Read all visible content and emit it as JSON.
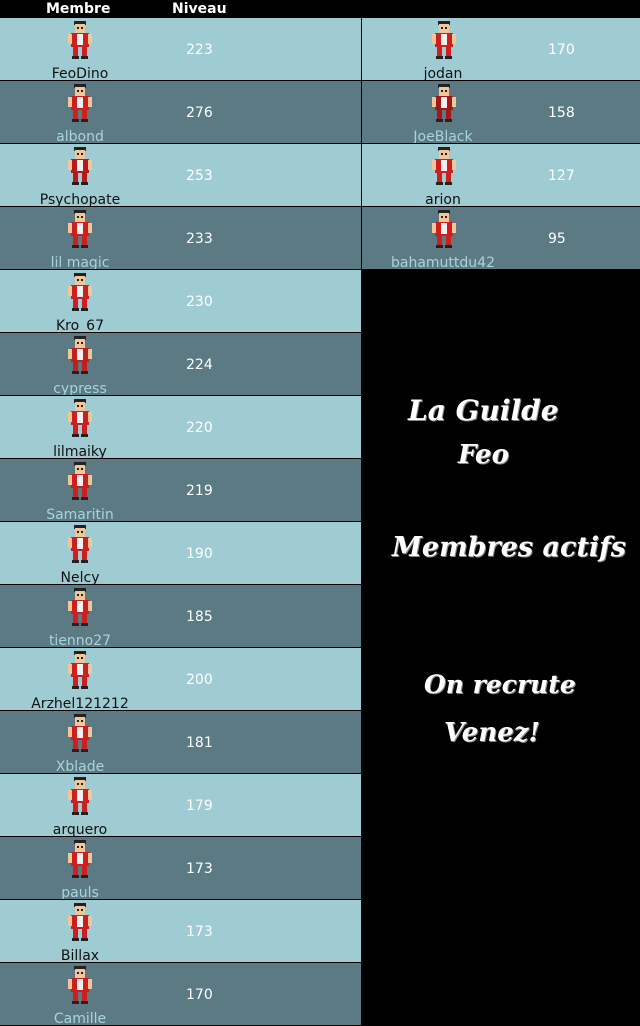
{
  "header": {
    "member_label": "Membre",
    "level_label": "Niveau"
  },
  "left_members": [
    {
      "name": "FeoDino",
      "level": "223",
      "shade": "light",
      "color": "#cc2020"
    },
    {
      "name": "albond",
      "level": "276",
      "shade": "dark",
      "color": "#cc2020"
    },
    {
      "name": "Psychopate",
      "level": "253",
      "shade": "light",
      "color": "#b81818"
    },
    {
      "name": "lil magic",
      "level": "233",
      "shade": "dark",
      "color": "#cc2020"
    },
    {
      "name": "Kro_67",
      "level": "230",
      "shade": "light",
      "color": "#cc2020"
    },
    {
      "name": "cypress",
      "level": "224",
      "shade": "dark",
      "color": "#c02020"
    },
    {
      "name": "lilmaiky",
      "level": "220",
      "shade": "light",
      "color": "#cc2020"
    },
    {
      "name": "Samaritin",
      "level": "219",
      "shade": "dark",
      "color": "#cc2020"
    },
    {
      "name": "Nelcy",
      "level": "190",
      "shade": "light",
      "color": "#cc2020"
    },
    {
      "name": "tienno27",
      "level": "185",
      "shade": "dark",
      "color": "#cc2020"
    },
    {
      "name": "Arzhel121212",
      "level": "200",
      "shade": "light",
      "color": "#cc2020"
    },
    {
      "name": "Xblade",
      "level": "181",
      "shade": "dark",
      "color": "#cc2020"
    },
    {
      "name": "arquero",
      "level": "179",
      "shade": "light",
      "color": "#cc2020"
    },
    {
      "name": "pauls",
      "level": "173",
      "shade": "dark",
      "color": "#cc2020"
    },
    {
      "name": "Billax",
      "level": "173",
      "shade": "light",
      "color": "#cc2020"
    },
    {
      "name": "Camille",
      "level": "170",
      "shade": "dark",
      "color": "#cc2020"
    }
  ],
  "right_members": [
    {
      "name": "jodan",
      "level": "170",
      "shade": "light",
      "color": "#cc2020"
    },
    {
      "name": "JoeBlack",
      "level": "158",
      "shade": "dark",
      "color": "#a01818"
    },
    {
      "name": "arion",
      "level": "127",
      "shade": "light",
      "color": "#cc2020"
    },
    {
      "name": "bahamuttdu42",
      "level": "95",
      "shade": "dark",
      "color": "#cc2020"
    }
  ],
  "banner": {
    "line1": "La Guilde",
    "line2": "Feo",
    "line3": "Membres actifs",
    "line4": "On recrute",
    "line5": "Venez!"
  }
}
